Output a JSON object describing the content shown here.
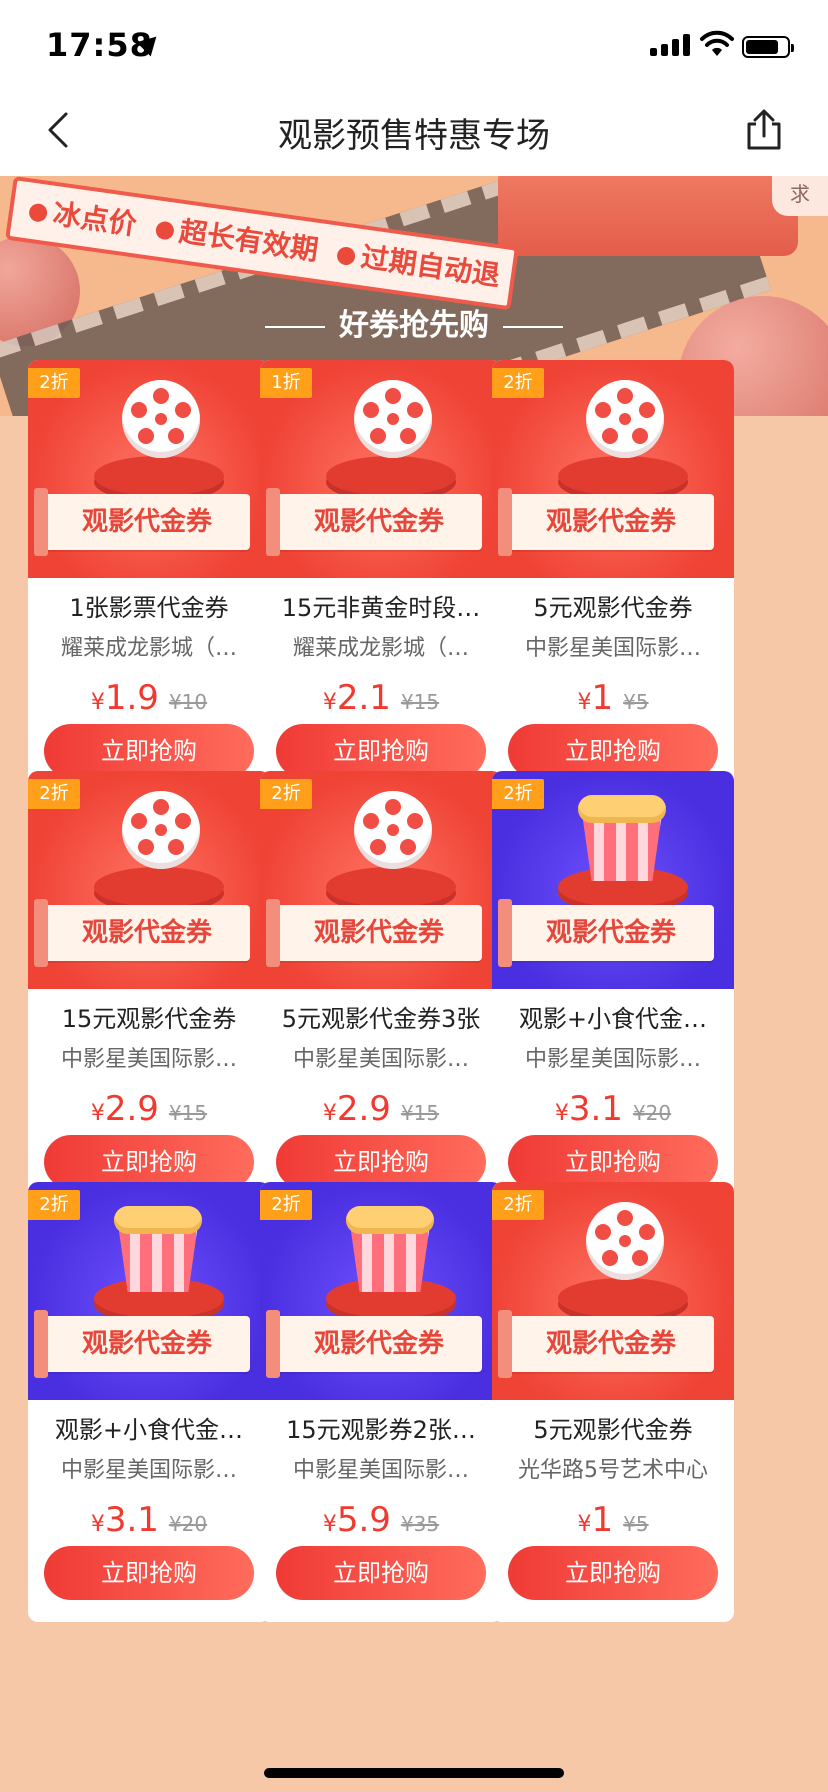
{
  "status_bar": {
    "time": "17:58"
  },
  "nav": {
    "title": "观影预售特惠专场"
  },
  "banner": {
    "tags": [
      "冰点价",
      "超长有效期",
      "过期自动退"
    ],
    "corner_text": "求",
    "section_title": "好券抢先购"
  },
  "products": [
    {
      "discount": "2折",
      "image": "film-reel",
      "theme": "red",
      "ticket_label": "观影代金券",
      "name": "1张影票代金券",
      "cinema": "耀莱成龙影城（…",
      "currency": "¥",
      "price": "1.9",
      "original": "¥10",
      "button": "立即抢购"
    },
    {
      "discount": "1折",
      "image": "film-reel",
      "theme": "red",
      "ticket_label": "观影代金券",
      "name": "15元非黄金时段…",
      "cinema": "耀莱成龙影城（…",
      "currency": "¥",
      "price": "2.1",
      "original": "¥15",
      "button": "立即抢购"
    },
    {
      "discount": "2折",
      "image": "film-reel",
      "theme": "red",
      "ticket_label": "观影代金券",
      "name": "5元观影代金券",
      "cinema": "中影星美国际影…",
      "currency": "¥",
      "price": "1",
      "original": "¥5",
      "button": "立即抢购"
    },
    {
      "discount": "2折",
      "image": "film-reel",
      "theme": "red",
      "ticket_label": "观影代金券",
      "name": "15元观影代金券",
      "cinema": "中影星美国际影…",
      "currency": "¥",
      "price": "2.9",
      "original": "¥15",
      "button": "立即抢购"
    },
    {
      "discount": "2折",
      "image": "film-reel",
      "theme": "red",
      "ticket_label": "观影代金券",
      "name": "5元观影代金券3张",
      "cinema": "中影星美国际影…",
      "currency": "¥",
      "price": "2.9",
      "original": "¥15",
      "button": "立即抢购"
    },
    {
      "discount": "2折",
      "image": "popcorn",
      "theme": "blue",
      "ticket_label": "观影代金券",
      "name": "观影+小食代金…",
      "cinema": "中影星美国际影…",
      "currency": "¥",
      "price": "3.1",
      "original": "¥20",
      "button": "立即抢购"
    },
    {
      "discount": "2折",
      "image": "popcorn",
      "theme": "blue",
      "ticket_label": "观影代金券",
      "name": "观影+小食代金…",
      "cinema": "中影星美国际影…",
      "currency": "¥",
      "price": "3.1",
      "original": "¥20",
      "button": "立即抢购"
    },
    {
      "discount": "2折",
      "image": "popcorn",
      "theme": "blue",
      "ticket_label": "观影代金券",
      "name": "15元观影券2张…",
      "cinema": "中影星美国际影…",
      "currency": "¥",
      "price": "5.9",
      "original": "¥35",
      "button": "立即抢购"
    },
    {
      "discount": "2折",
      "image": "film-reel",
      "theme": "red",
      "ticket_label": "观影代金券",
      "name": "5元观影代金券",
      "cinema": "光华路5号艺术中心",
      "currency": "¥",
      "price": "1",
      "original": "¥5",
      "button": "立即抢购"
    }
  ],
  "colors": {
    "accent": "#f03a2f",
    "badge": "#ff9f1a",
    "background": "#f7c8a7"
  }
}
